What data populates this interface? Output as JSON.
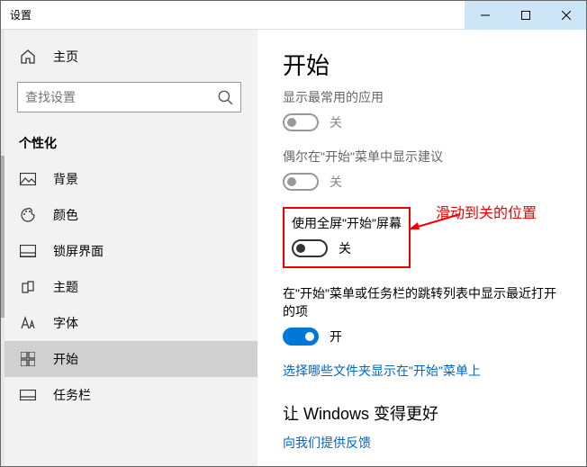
{
  "titlebar": {
    "title": "设置"
  },
  "sidebar": {
    "home_label": "主页",
    "search_placeholder": "查找设置",
    "section_header": "个性化",
    "items": [
      {
        "label": "背景"
      },
      {
        "label": "颜色"
      },
      {
        "label": "锁屏界面"
      },
      {
        "label": "主题"
      },
      {
        "label": "字体"
      },
      {
        "label": "开始"
      },
      {
        "label": "任务栏"
      }
    ]
  },
  "content": {
    "page_title": "开始",
    "settings": [
      {
        "label": "显示最常用的应用",
        "state_label": "关",
        "on": false,
        "disabled": true
      },
      {
        "label": "偶尔在\"开始\"菜单中显示建议",
        "state_label": "关",
        "on": false,
        "disabled": true
      },
      {
        "label": "使用全屏\"开始\"屏幕",
        "state_label": "关",
        "on": false,
        "disabled": false
      },
      {
        "label": "在\"开始\"菜单或任务栏的跳转列表中显示最近打开的项",
        "state_label": "开",
        "on": true,
        "disabled": false
      }
    ],
    "link1": "选择哪些文件夹显示在\"开始\"菜单上",
    "section_title": "让 Windows 变得更好",
    "link2": "向我们提供反馈"
  },
  "annotation": {
    "text": "滑动到关的位置"
  }
}
